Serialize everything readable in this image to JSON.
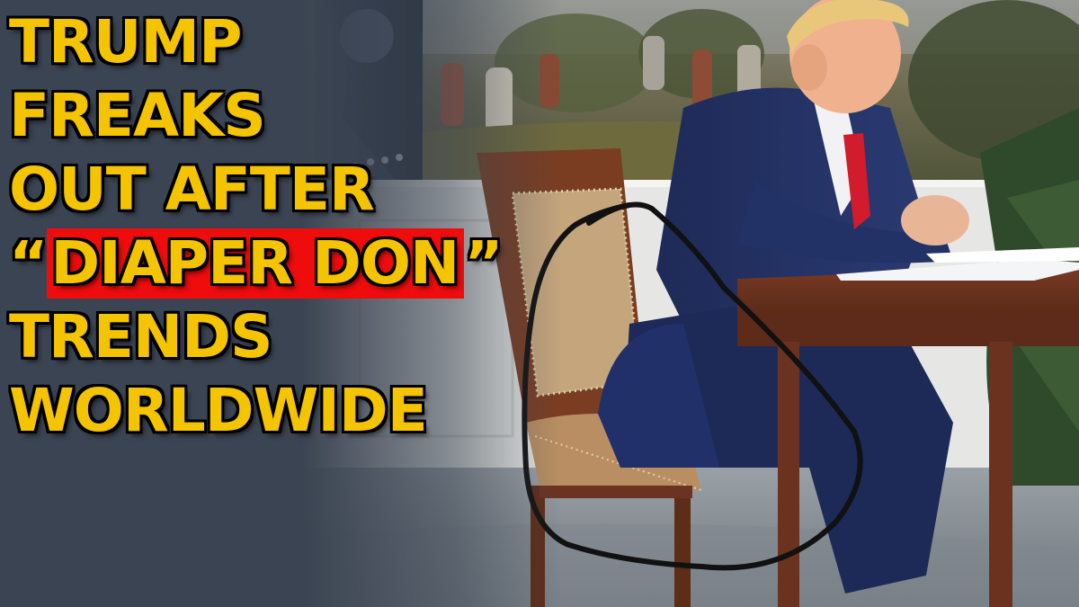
{
  "headline": {
    "line1": "TRUMP",
    "line2": "FREAKS",
    "line3": "OUT AFTER",
    "open_quote": "“",
    "highlight": "DIAPER DON",
    "close_quote": "”",
    "line5": "TRENDS",
    "line6": "WORLDWIDE"
  },
  "colors": {
    "headline_text": "#f5c400",
    "highlight_bg": "#ee0c0c",
    "left_panel": "#3b4452",
    "circle_marker": "#111111"
  }
}
